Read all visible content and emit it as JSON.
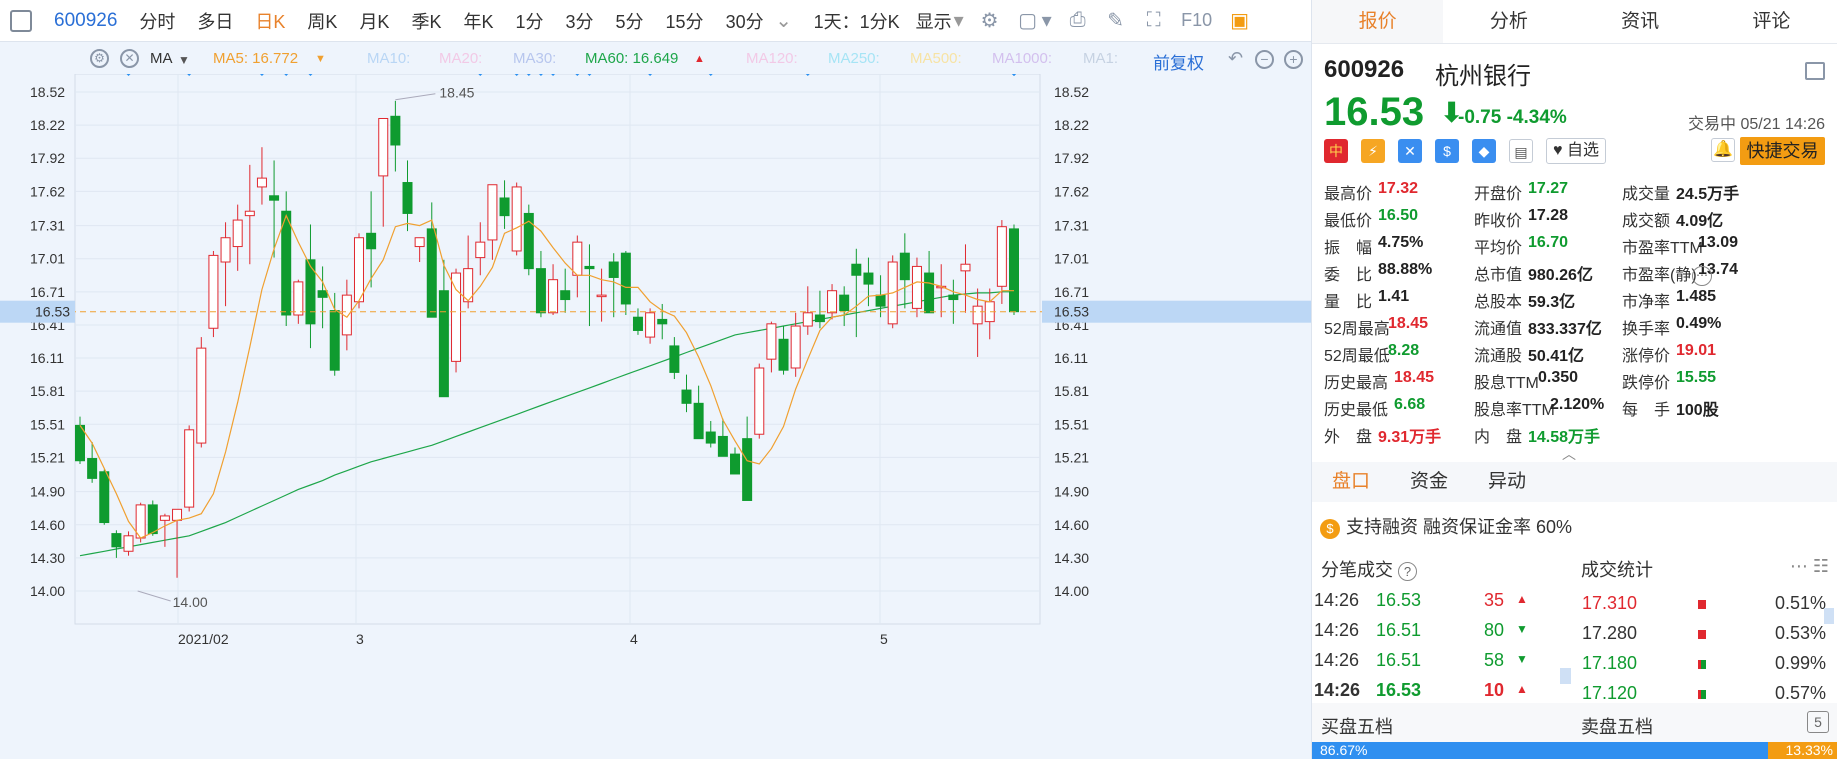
{
  "toolbar": {
    "code": "600926",
    "periods": [
      "分时",
      "多日",
      "日K",
      "周K",
      "月K",
      "季K",
      "年K",
      "1分",
      "3分",
      "5分",
      "15分",
      "30分"
    ],
    "active_period": "日K",
    "chevron": "⌄",
    "multi_label": "1天：1分K",
    "display_label": "显示",
    "f10": "F10"
  },
  "ma_bar": {
    "type_label": "MA",
    "ma5": "MA5: 16.772",
    "ma10": "MA10:",
    "ma20": "MA20:",
    "ma30": "MA30:",
    "ma60": "MA60: 16.649",
    "ma120": "MA120:",
    "ma250": "MA250:",
    "ma500": "MA500:",
    "ma1000": "MA1000:",
    "ma1": "MA1:",
    "adjust": "前复权",
    "ma5_color": "#f0a030",
    "ma60_color": "#1ea64a"
  },
  "chart_data": {
    "type": "candlestick",
    "y_ticks": [
      "18.52",
      "18.22",
      "17.92",
      "17.62",
      "17.31",
      "17.01",
      "16.71",
      "16.41",
      "16.11",
      "15.81",
      "15.51",
      "15.21",
      "14.90",
      "14.60",
      "14.30",
      "14.00"
    ],
    "x_labels": [
      "2021/02",
      "3",
      "4",
      "5"
    ],
    "last_price": "16.53",
    "max_label": "18.45",
    "min_label": "14.00",
    "ohlc": [
      [
        15.5,
        15.58,
        15.15,
        15.18
      ],
      [
        15.2,
        15.35,
        14.98,
        15.02
      ],
      [
        15.08,
        15.1,
        14.6,
        14.62
      ],
      [
        14.52,
        14.55,
        14.3,
        14.4
      ],
      [
        14.36,
        14.54,
        14.32,
        14.5
      ],
      [
        14.48,
        14.8,
        14.44,
        14.78
      ],
      [
        14.78,
        14.82,
        14.5,
        14.52
      ],
      [
        14.64,
        14.7,
        14.4,
        14.68
      ],
      [
        14.64,
        14.7,
        14.12,
        14.74
      ],
      [
        14.76,
        15.5,
        14.72,
        15.46
      ],
      [
        15.34,
        16.3,
        15.3,
        16.2
      ],
      [
        16.38,
        17.08,
        16.3,
        17.04
      ],
      [
        16.98,
        17.34,
        16.58,
        17.2
      ],
      [
        17.12,
        17.5,
        16.9,
        17.36
      ],
      [
        17.4,
        17.86,
        16.96,
        17.44
      ],
      [
        17.66,
        18.02,
        17.5,
        17.74
      ],
      [
        17.58,
        17.9,
        17.02,
        17.54
      ],
      [
        17.44,
        17.62,
        16.4,
        16.5
      ],
      [
        16.5,
        16.82,
        16.42,
        16.8
      ],
      [
        17.0,
        17.32,
        16.2,
        16.42
      ],
      [
        16.72,
        16.94,
        16.38,
        16.66
      ],
      [
        16.54,
        16.7,
        15.95,
        16.0
      ],
      [
        16.32,
        16.82,
        16.18,
        16.68
      ],
      [
        16.62,
        17.24,
        16.56,
        17.2
      ],
      [
        17.24,
        17.62,
        16.75,
        17.1
      ],
      [
        17.76,
        18.26,
        17.3,
        18.28
      ],
      [
        18.3,
        18.44,
        17.8,
        18.04
      ],
      [
        17.7,
        17.9,
        17.26,
        17.42
      ],
      [
        17.12,
        17.2,
        16.98,
        17.2
      ],
      [
        17.28,
        17.52,
        16.56,
        16.48
      ],
      [
        16.72,
        17.0,
        15.82,
        15.76
      ],
      [
        16.08,
        16.92,
        15.98,
        16.88
      ],
      [
        16.62,
        17.22,
        16.56,
        16.92
      ],
      [
        17.02,
        17.34,
        16.86,
        17.16
      ],
      [
        17.18,
        17.68,
        17.0,
        17.68
      ],
      [
        17.56,
        17.72,
        17.28,
        17.4
      ],
      [
        17.08,
        17.7,
        17.04,
        17.66
      ],
      [
        17.42,
        17.5,
        16.86,
        16.92
      ],
      [
        16.92,
        17.08,
        16.48,
        16.52
      ],
      [
        16.52,
        16.96,
        16.5,
        16.82
      ],
      [
        16.72,
        16.92,
        16.52,
        16.64
      ],
      [
        16.86,
        17.22,
        16.66,
        17.16
      ],
      [
        16.94,
        17.14,
        16.4,
        16.92
      ],
      [
        16.68,
        16.92,
        16.44,
        16.68
      ],
      [
        16.98,
        17.06,
        16.48,
        16.84
      ],
      [
        17.06,
        17.08,
        16.5,
        16.6
      ],
      [
        16.48,
        16.56,
        16.32,
        16.36
      ],
      [
        16.3,
        16.56,
        16.24,
        16.52
      ],
      [
        16.46,
        16.6,
        16.28,
        16.42
      ],
      [
        16.22,
        16.3,
        15.92,
        15.98
      ],
      [
        15.82,
        15.96,
        15.62,
        15.7
      ],
      [
        15.7,
        15.86,
        15.44,
        15.38
      ],
      [
        15.44,
        15.54,
        15.3,
        15.34
      ],
      [
        15.4,
        15.56,
        15.28,
        15.22
      ],
      [
        15.24,
        15.3,
        15.08,
        15.06
      ],
      [
        15.38,
        15.58,
        14.88,
        14.82
      ],
      [
        15.42,
        16.06,
        15.38,
        16.02
      ],
      [
        16.1,
        16.44,
        15.98,
        16.42
      ],
      [
        16.28,
        16.4,
        15.96,
        16.0
      ],
      [
        16.02,
        16.52,
        15.94,
        16.4
      ],
      [
        16.4,
        16.76,
        16.32,
        16.52
      ],
      [
        16.5,
        16.72,
        16.38,
        16.44
      ],
      [
        16.52,
        16.78,
        16.46,
        16.72
      ],
      [
        16.68,
        16.76,
        16.4,
        16.54
      ],
      [
        16.96,
        17.1,
        16.3,
        16.86
      ],
      [
        16.88,
        17.02,
        16.58,
        16.78
      ],
      [
        16.68,
        16.86,
        16.48,
        16.58
      ],
      [
        16.42,
        17.04,
        16.38,
        16.98
      ],
      [
        17.06,
        17.24,
        16.56,
        16.82
      ],
      [
        16.56,
        17.02,
        16.48,
        16.94
      ],
      [
        16.88,
        17.08,
        16.6,
        16.52
      ],
      [
        16.76,
        16.96,
        16.48,
        16.76
      ],
      [
        16.68,
        16.82,
        16.42,
        16.64
      ],
      [
        16.9,
        17.14,
        16.52,
        16.96
      ],
      [
        16.42,
        16.74,
        16.12,
        16.58
      ],
      [
        16.44,
        16.74,
        16.28,
        16.62
      ],
      [
        16.76,
        17.36,
        16.6,
        17.3
      ],
      [
        17.28,
        17.32,
        16.5,
        16.53
      ]
    ],
    "ma5": [
      15.5,
      15.34,
      15.11,
      14.88,
      14.63,
      14.48,
      14.53,
      14.59,
      14.64,
      14.66,
      14.7,
      14.88,
      15.26,
      15.71,
      16.21,
      16.73,
      17.1,
      17.4,
      17.16,
      16.94,
      16.8,
      16.55,
      16.48,
      16.63,
      16.83,
      17.0,
      17.3,
      17.33,
      17.31,
      17.36,
      16.95,
      16.73,
      16.63,
      16.76,
      16.93,
      17.24,
      17.29,
      17.35,
      17.26,
      17.11,
      16.97,
      16.86,
      16.86,
      16.82,
      16.8,
      16.75,
      16.75,
      16.62,
      16.54,
      16.49,
      16.34,
      16.12,
      15.86,
      15.55,
      15.36,
      15.18,
      15.15,
      15.29,
      15.49,
      15.83,
      16.1,
      16.36,
      16.48,
      16.5,
      16.58,
      16.67,
      16.68,
      16.7,
      16.75,
      16.8,
      16.79,
      16.76,
      16.71,
      16.68,
      16.64,
      16.62,
      16.72,
      16.72
    ],
    "ma60": [
      14.32,
      14.34,
      14.36,
      14.38,
      14.4,
      14.42,
      14.44,
      14.46,
      14.48,
      14.5,
      14.54,
      14.58,
      14.62,
      14.67,
      14.72,
      14.77,
      14.82,
      14.87,
      14.92,
      14.96,
      15.0,
      15.05,
      15.09,
      15.13,
      15.17,
      15.2,
      15.23,
      15.26,
      15.29,
      15.32,
      15.36,
      15.4,
      15.44,
      15.48,
      15.52,
      15.56,
      15.6,
      15.64,
      15.68,
      15.72,
      15.76,
      15.8,
      15.84,
      15.88,
      15.92,
      15.96,
      16.0,
      16.04,
      16.08,
      16.12,
      16.16,
      16.2,
      16.24,
      16.28,
      16.32,
      16.34,
      16.36,
      16.38,
      16.4,
      16.42,
      16.44,
      16.46,
      16.48,
      16.5,
      16.52,
      16.54,
      16.56,
      16.58,
      16.6,
      16.62,
      16.64,
      16.66,
      16.68,
      16.69,
      16.7,
      16.7,
      16.71,
      16.71
    ]
  },
  "quote": {
    "code": "600926",
    "name": "杭州银行",
    "price": "16.53",
    "arrow": "⬇",
    "change": "-0.75",
    "change_pct": "-4.34%",
    "status": "交易中 05/21 14:26",
    "badge_cn": "中",
    "badge_bolt": "⚡",
    "badge_x": "✕",
    "badge_s": "$",
    "badge_tag": "◆",
    "badge_doc": "▤",
    "watch_label": "自选",
    "bell": "🔔",
    "quick_trade": "快捷交易"
  },
  "stats": [
    [
      {
        "l": "最高价",
        "v": "17.32",
        "c": "red"
      },
      {
        "l": "开盘价",
        "v": "17.27",
        "c": "green"
      },
      {
        "l": "成交量",
        "v": "24.5万手",
        "c": "dark"
      }
    ],
    [
      {
        "l": "最低价",
        "v": "16.50",
        "c": "green"
      },
      {
        "l": "昨收价",
        "v": "17.28",
        "c": "dark"
      },
      {
        "l": "成交额",
        "v": "4.09亿",
        "c": "dark"
      }
    ],
    [
      {
        "l": "振　幅",
        "v": "4.75%",
        "c": "dark"
      },
      {
        "l": "平均价",
        "v": "16.70",
        "c": "green"
      },
      {
        "l": "市盈率TTM",
        "v": "13.09",
        "c": "dark"
      }
    ],
    [
      {
        "l": "委　比",
        "v": "88.88%",
        "c": "dark"
      },
      {
        "l": "总市值",
        "v": "980.26亿",
        "c": "dark"
      },
      {
        "l": "市盈率(静)",
        "v": "13.74",
        "c": "dark"
      }
    ],
    [
      {
        "l": "量　比",
        "v": "1.41",
        "c": "dark"
      },
      {
        "l": "总股本",
        "v": "59.3亿",
        "c": "dark"
      },
      {
        "l": "市净率",
        "v": "1.485",
        "c": "dark"
      }
    ],
    [
      {
        "l": "52周最高",
        "v": "18.45",
        "c": "red"
      },
      {
        "l": "流通值",
        "v": "833.337亿",
        "c": "dark"
      },
      {
        "l": "换手率",
        "v": "0.49%",
        "c": "dark"
      }
    ],
    [
      {
        "l": "52周最低",
        "v": "8.28",
        "c": "green"
      },
      {
        "l": "流通股",
        "v": "50.41亿",
        "c": "dark"
      },
      {
        "l": "涨停价",
        "v": "19.01",
        "c": "red"
      }
    ],
    [
      {
        "l": "历史最高",
        "v": "18.45",
        "c": "red"
      },
      {
        "l": "股息TTM",
        "v": "0.350",
        "c": "dark"
      },
      {
        "l": "跌停价",
        "v": "15.55",
        "c": "green"
      }
    ],
    [
      {
        "l": "历史最低",
        "v": "6.68",
        "c": "green"
      },
      {
        "l": "股息率TTM",
        "v": "2.120%",
        "c": "dark"
      },
      {
        "l": "每　手",
        "v": "100股",
        "c": "dark"
      }
    ],
    [
      {
        "l": "外　盘",
        "v": "9.31万手",
        "c": "red"
      },
      {
        "l": "内　盘",
        "v": "14.58万手",
        "c": "green"
      },
      {
        "l": "",
        "v": "",
        "c": "dark"
      }
    ]
  ],
  "stats_more": "⋯",
  "expand_icon": "︿",
  "tabs": [
    "报价",
    "分析",
    "资讯",
    "评论"
  ],
  "subtabs": [
    "盘口",
    "资金",
    "异动"
  ],
  "margin_icon": "$",
  "margin_text": "支持融资  融资保证金率 60%",
  "trades_title": "分笔成交",
  "trades_help": "?",
  "stats_title": "成交统计",
  "header_icons": "⋯  ☷",
  "trades": [
    {
      "t": "14:26",
      "p": "16.53",
      "v": "35",
      "d": "▲",
      "c": "red"
    },
    {
      "t": "14:26",
      "p": "16.51",
      "v": "80",
      "d": "▼",
      "c": "green"
    },
    {
      "t": "14:26",
      "p": "16.51",
      "v": "58",
      "d": "▼",
      "c": "green"
    },
    {
      "t": "14:26",
      "p": "16.53",
      "v": "10",
      "d": "▲",
      "c": "red",
      "bold": true
    }
  ],
  "vol_stats": [
    {
      "p": "17.310",
      "pct": "0.51%",
      "c": "red"
    },
    {
      "p": "17.280",
      "pct": "0.53%",
      "c": "dark"
    },
    {
      "p": "17.180",
      "pct": "0.99%",
      "c": "green"
    },
    {
      "p": "17.120",
      "pct": "0.57%",
      "c": "green"
    }
  ],
  "book": {
    "buy_label": "买盘五档",
    "sell_label": "卖盘五档",
    "buy_pct": "86.67%",
    "sell_pct": "13.33%",
    "corner_icon": "5"
  }
}
